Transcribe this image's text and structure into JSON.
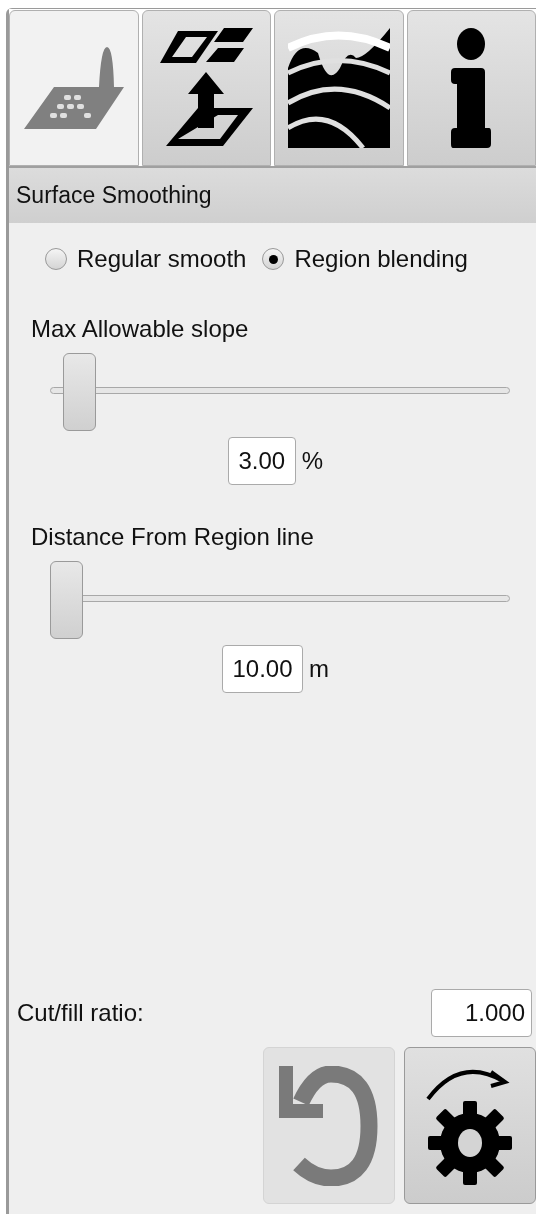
{
  "tabs": [
    {
      "kind": "surface",
      "selected": true
    },
    {
      "kind": "import",
      "selected": false
    },
    {
      "kind": "layers",
      "selected": false
    },
    {
      "kind": "info",
      "selected": false
    }
  ],
  "panel": {
    "title": "Surface Smoothing",
    "modes": [
      {
        "label": "Regular smooth",
        "selected": false
      },
      {
        "label": "Region blending",
        "selected": true
      }
    ],
    "sliders": [
      {
        "label": "Max Allowable slope",
        "level": 0.03,
        "value": "3.00",
        "unit": "%"
      },
      {
        "label": "Distance From Region line",
        "level": 0,
        "value": "10.00",
        "unit": "m"
      }
    ],
    "ratio": {
      "label": "Cut/fill ratio:",
      "value": "1.000"
    },
    "buttons": [
      {
        "kind": "undo",
        "disabled": true
      },
      {
        "kind": "apply",
        "disabled": false
      }
    ]
  }
}
